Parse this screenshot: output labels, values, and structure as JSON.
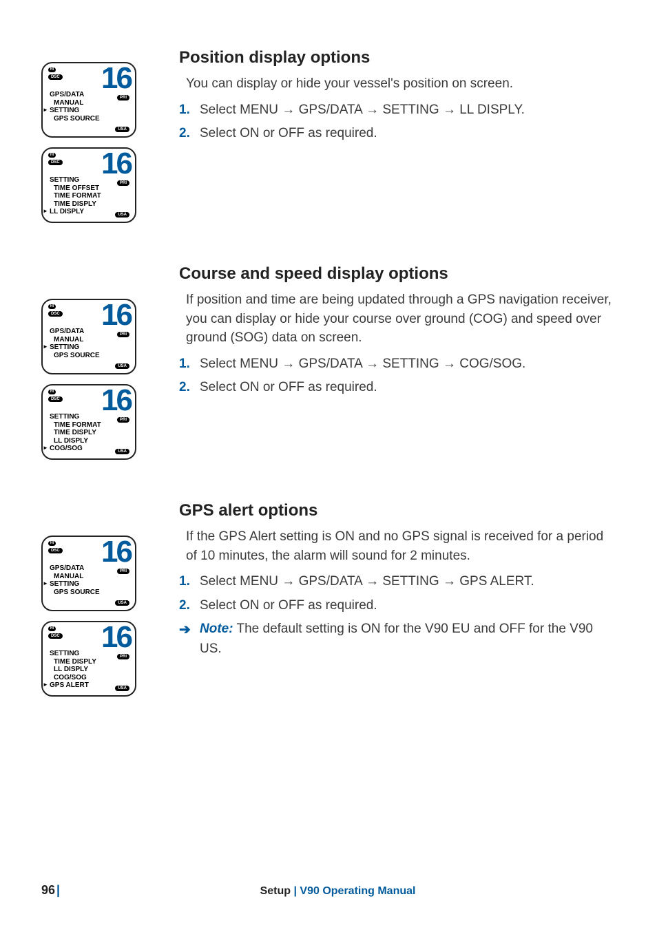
{
  "sections": {
    "position": {
      "heading": "Position display options",
      "intro": "You can display or hide your vessel's position on screen.",
      "steps": [
        {
          "num": "1.",
          "text": "Select MENU → GPS/DATA → SETTING → LL DISPLY."
        },
        {
          "num": "2.",
          "text": "Select ON or OFF as required."
        }
      ],
      "screens": [
        {
          "channel": "16",
          "lines": [
            "GPS/DATA",
            "MANUAL",
            "SETTING",
            "GPS SOURCE"
          ],
          "selected": 2,
          "indents": [
            false,
            true,
            true,
            true
          ]
        },
        {
          "channel": "16",
          "lines": [
            "SETTING",
            "TIME OFFSET",
            "TIME FORMAT",
            "TIME DISPLY",
            "LL DISPLY"
          ],
          "selected": 4,
          "indents": [
            false,
            true,
            true,
            true,
            false
          ]
        }
      ]
    },
    "course": {
      "heading": "Course and speed display options",
      "intro": "If position and time are being updated through a GPS navigation receiver, you can display or hide your course over ground (COG) and speed over ground (SOG) data on screen.",
      "steps": [
        {
          "num": "1.",
          "text": "Select MENU → GPS/DATA → SETTING → COG/SOG."
        },
        {
          "num": "2.",
          "text": "Select ON or OFF as required."
        }
      ],
      "screens": [
        {
          "channel": "16",
          "lines": [
            "GPS/DATA",
            "MANUAL",
            "SETTING",
            "GPS SOURCE"
          ],
          "selected": 2,
          "indents": [
            false,
            true,
            true,
            true
          ]
        },
        {
          "channel": "16",
          "lines": [
            "SETTING",
            "TIME FORMAT",
            "TIME DISPLY",
            "LL DISPLY",
            "COG/SOG"
          ],
          "selected": 4,
          "indents": [
            false,
            true,
            true,
            true,
            false
          ]
        }
      ]
    },
    "gpsalert": {
      "heading": "GPS alert options",
      "intro": "If the GPS Alert setting is ON and no GPS signal is received for a period of 10 minutes, the alarm will sound for 2 minutes.",
      "steps": [
        {
          "num": "1.",
          "text": "Select MENU → GPS/DATA → SETTING → GPS ALERT."
        },
        {
          "num": "2.",
          "text": "Select ON or OFF as required."
        }
      ],
      "note": {
        "label": "Note:",
        "text": " The default setting is ON for the V90 EU and OFF for the V90 US."
      },
      "screens": [
        {
          "channel": "16",
          "lines": [
            "GPS/DATA",
            "MANUAL",
            "SETTING",
            "GPS SOURCE"
          ],
          "selected": 2,
          "indents": [
            false,
            true,
            true,
            true
          ]
        },
        {
          "channel": "16",
          "lines": [
            "SETTING",
            "TIME DISPLY",
            "LL DISPLY",
            "COG/SOG",
            "GPS ALERT"
          ],
          "selected": 4,
          "indents": [
            false,
            true,
            true,
            true,
            false
          ]
        }
      ]
    }
  },
  "badges": {
    "hi": "HI",
    "dsc": "DSC",
    "pri": "PRI",
    "usa": "USA"
  },
  "footer": {
    "page": "96",
    "divider": "|",
    "section": "Setup",
    "sep": " | ",
    "manual": "V90 Operating Manual"
  }
}
